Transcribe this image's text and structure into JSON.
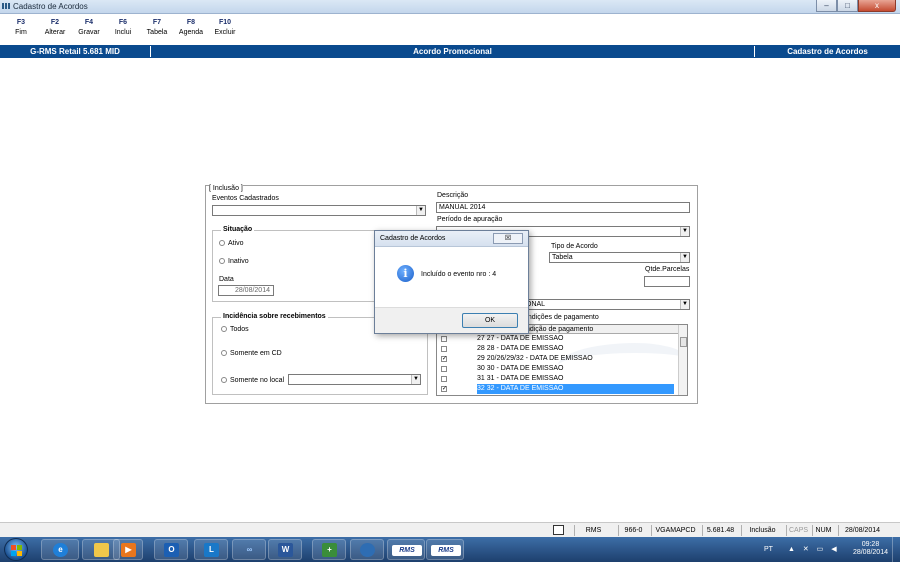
{
  "window": {
    "title": "Cadastro de Acordos",
    "controls": [
      "–",
      "□",
      "x"
    ]
  },
  "fkeys": [
    {
      "key": "F3",
      "label": "Fim"
    },
    {
      "key": "F2",
      "label": "Alterar"
    },
    {
      "key": "F4",
      "label": "Gravar"
    },
    {
      "key": "F6",
      "label": "Inclui"
    },
    {
      "key": "F7",
      "label": "Tabela"
    },
    {
      "key": "F8",
      "label": "Agenda"
    },
    {
      "key": "F10",
      "label": "Excluir"
    }
  ],
  "header": {
    "left": "G-RMS Retail 5.681 MID",
    "center": "Acordo Promocional",
    "right": "Cadastro de Acordos"
  },
  "form": {
    "mode": "[ Inclusão ]",
    "eventos_label": "Eventos Cadastrados",
    "eventos_value": "",
    "descricao_label": "Descrição",
    "descricao_value": "MANUAL 2014",
    "periodo_label": "Período de apuração",
    "situacao_title": "Situação",
    "situacao_options": [
      "Ativo",
      "Inativo"
    ],
    "data_label": "Data",
    "data_value": "28/08/2014",
    "tipo_label": "Tipo de Acordo",
    "tipo_value": "Tabela",
    "qtde_label": "Qtde.Parcelas",
    "qtde_value": "",
    "promo_value": "CIONAL",
    "condicoes_label": "ondições de pagamento",
    "incidencia_title": "Incidência sobre recebimentos",
    "incidencia_options": [
      "Todos",
      "Somente em CD",
      "Somente no local"
    ],
    "local_value": ""
  },
  "payments": {
    "header": "Condição de pagamento",
    "rows": [
      {
        "checked": false,
        "text": "27  27 - DATA DE EMISSAO",
        "selected": false
      },
      {
        "checked": false,
        "text": "28  28 - DATA DE EMISSAO",
        "selected": false
      },
      {
        "checked": true,
        "text": "29  20/26/29/32 - DATA DE EMISSAO",
        "selected": false
      },
      {
        "checked": false,
        "text": "30  30 - DATA DE EMISSAO",
        "selected": false
      },
      {
        "checked": false,
        "text": "31  31 - DATA DE EMISSAO",
        "selected": false
      },
      {
        "checked": true,
        "text": "32  32 - DATA DE EMISSAO",
        "selected": true
      }
    ]
  },
  "dialog": {
    "title": "Cadastro de Acordos",
    "close": "☒",
    "message": "Incluído o evento nro : 4",
    "ok": "OK"
  },
  "status": {
    "cells": [
      "RMS",
      "966-0",
      "VGAMAPCD",
      "5.681.48",
      "Inclusão",
      "CAPS",
      "NUM",
      "28/08/2014"
    ]
  },
  "taskbar": {
    "rms1": "RMS",
    "rms2": "RMS",
    "lang": "PT",
    "time": "09:28",
    "date": "28/08/2014"
  }
}
